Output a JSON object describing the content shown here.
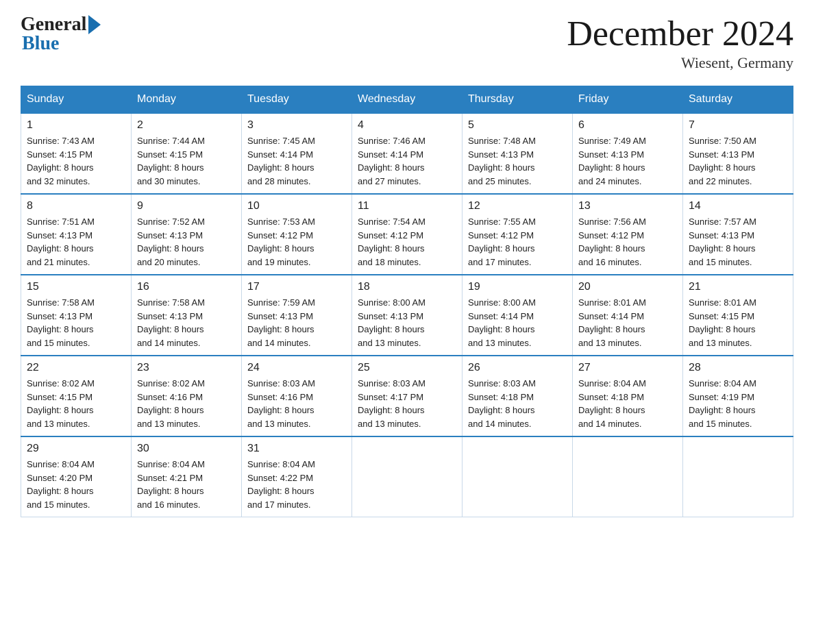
{
  "logo": {
    "general": "General",
    "blue": "Blue"
  },
  "title": {
    "month": "December 2024",
    "location": "Wiesent, Germany"
  },
  "header": {
    "days": [
      "Sunday",
      "Monday",
      "Tuesday",
      "Wednesday",
      "Thursday",
      "Friday",
      "Saturday"
    ]
  },
  "weeks": [
    [
      {
        "day": "1",
        "sunrise": "7:43 AM",
        "sunset": "4:15 PM",
        "daylight": "8 hours and 32 minutes."
      },
      {
        "day": "2",
        "sunrise": "7:44 AM",
        "sunset": "4:15 PM",
        "daylight": "8 hours and 30 minutes."
      },
      {
        "day": "3",
        "sunrise": "7:45 AM",
        "sunset": "4:14 PM",
        "daylight": "8 hours and 28 minutes."
      },
      {
        "day": "4",
        "sunrise": "7:46 AM",
        "sunset": "4:14 PM",
        "daylight": "8 hours and 27 minutes."
      },
      {
        "day": "5",
        "sunrise": "7:48 AM",
        "sunset": "4:13 PM",
        "daylight": "8 hours and 25 minutes."
      },
      {
        "day": "6",
        "sunrise": "7:49 AM",
        "sunset": "4:13 PM",
        "daylight": "8 hours and 24 minutes."
      },
      {
        "day": "7",
        "sunrise": "7:50 AM",
        "sunset": "4:13 PM",
        "daylight": "8 hours and 22 minutes."
      }
    ],
    [
      {
        "day": "8",
        "sunrise": "7:51 AM",
        "sunset": "4:13 PM",
        "daylight": "8 hours and 21 minutes."
      },
      {
        "day": "9",
        "sunrise": "7:52 AM",
        "sunset": "4:13 PM",
        "daylight": "8 hours and 20 minutes."
      },
      {
        "day": "10",
        "sunrise": "7:53 AM",
        "sunset": "4:12 PM",
        "daylight": "8 hours and 19 minutes."
      },
      {
        "day": "11",
        "sunrise": "7:54 AM",
        "sunset": "4:12 PM",
        "daylight": "8 hours and 18 minutes."
      },
      {
        "day": "12",
        "sunrise": "7:55 AM",
        "sunset": "4:12 PM",
        "daylight": "8 hours and 17 minutes."
      },
      {
        "day": "13",
        "sunrise": "7:56 AM",
        "sunset": "4:12 PM",
        "daylight": "8 hours and 16 minutes."
      },
      {
        "day": "14",
        "sunrise": "7:57 AM",
        "sunset": "4:13 PM",
        "daylight": "8 hours and 15 minutes."
      }
    ],
    [
      {
        "day": "15",
        "sunrise": "7:58 AM",
        "sunset": "4:13 PM",
        "daylight": "8 hours and 15 minutes."
      },
      {
        "day": "16",
        "sunrise": "7:58 AM",
        "sunset": "4:13 PM",
        "daylight": "8 hours and 14 minutes."
      },
      {
        "day": "17",
        "sunrise": "7:59 AM",
        "sunset": "4:13 PM",
        "daylight": "8 hours and 14 minutes."
      },
      {
        "day": "18",
        "sunrise": "8:00 AM",
        "sunset": "4:13 PM",
        "daylight": "8 hours and 13 minutes."
      },
      {
        "day": "19",
        "sunrise": "8:00 AM",
        "sunset": "4:14 PM",
        "daylight": "8 hours and 13 minutes."
      },
      {
        "day": "20",
        "sunrise": "8:01 AM",
        "sunset": "4:14 PM",
        "daylight": "8 hours and 13 minutes."
      },
      {
        "day": "21",
        "sunrise": "8:01 AM",
        "sunset": "4:15 PM",
        "daylight": "8 hours and 13 minutes."
      }
    ],
    [
      {
        "day": "22",
        "sunrise": "8:02 AM",
        "sunset": "4:15 PM",
        "daylight": "8 hours and 13 minutes."
      },
      {
        "day": "23",
        "sunrise": "8:02 AM",
        "sunset": "4:16 PM",
        "daylight": "8 hours and 13 minutes."
      },
      {
        "day": "24",
        "sunrise": "8:03 AM",
        "sunset": "4:16 PM",
        "daylight": "8 hours and 13 minutes."
      },
      {
        "day": "25",
        "sunrise": "8:03 AM",
        "sunset": "4:17 PM",
        "daylight": "8 hours and 13 minutes."
      },
      {
        "day": "26",
        "sunrise": "8:03 AM",
        "sunset": "4:18 PM",
        "daylight": "8 hours and 14 minutes."
      },
      {
        "day": "27",
        "sunrise": "8:04 AM",
        "sunset": "4:18 PM",
        "daylight": "8 hours and 14 minutes."
      },
      {
        "day": "28",
        "sunrise": "8:04 AM",
        "sunset": "4:19 PM",
        "daylight": "8 hours and 15 minutes."
      }
    ],
    [
      {
        "day": "29",
        "sunrise": "8:04 AM",
        "sunset": "4:20 PM",
        "daylight": "8 hours and 15 minutes."
      },
      {
        "day": "30",
        "sunrise": "8:04 AM",
        "sunset": "4:21 PM",
        "daylight": "8 hours and 16 minutes."
      },
      {
        "day": "31",
        "sunrise": "8:04 AM",
        "sunset": "4:22 PM",
        "daylight": "8 hours and 17 minutes."
      },
      null,
      null,
      null,
      null
    ]
  ],
  "labels": {
    "sunrise": "Sunrise:",
    "sunset": "Sunset:",
    "daylight": "Daylight:"
  }
}
